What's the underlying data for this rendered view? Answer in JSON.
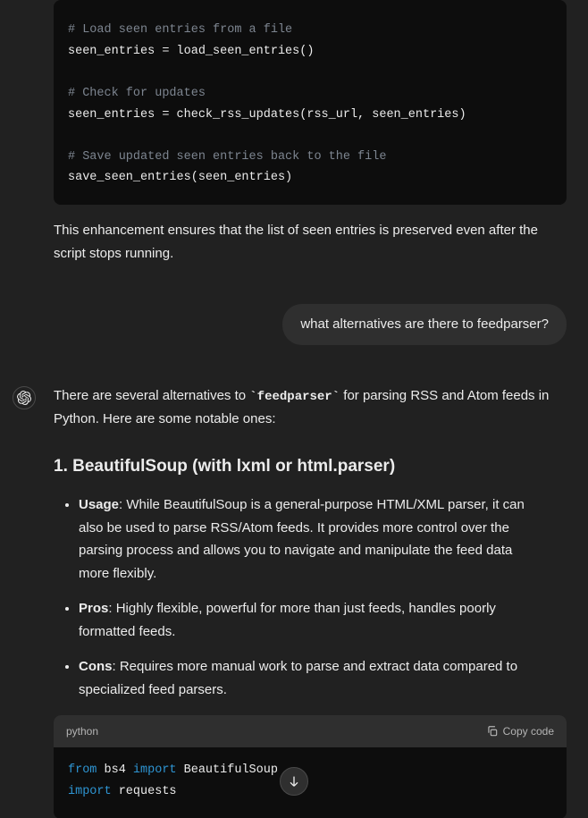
{
  "code1": {
    "c1": "# Load seen entries from a file",
    "l1": "seen_entries = load_seen_entries()",
    "c2": "# Check for updates",
    "l2": "seen_entries = check_rss_updates(rss_url, seen_entries)",
    "c3": "# Save updated seen entries back to the file",
    "l3": "save_seen_entries(seen_entries)"
  },
  "para1": "This enhancement ensures that the list of seen entries is preserved even after the script stops running.",
  "user_q": "what alternatives are there to feedparser?",
  "intro_pre": "There are several alternatives to ",
  "intro_code": "`feedparser`",
  "intro_post": " for parsing RSS and Atom feeds in Python. Here are some notable ones:",
  "heading1": "1. BeautifulSoup (with lxml or html.parser)",
  "bullets": {
    "usage_label": "Usage",
    "usage_text": ": While BeautifulSoup is a general-purpose HTML/XML parser, it can also be used to parse RSS/Atom feeds. It provides more control over the parsing process and allows you to navigate and manipulate the feed data more flexibly.",
    "pros_label": "Pros",
    "pros_text": ": Highly flexible, powerful for more than just feeds, handles poorly formatted feeds.",
    "cons_label": "Cons",
    "cons_text": ": Requires more manual work to parse and extract data compared to specialized feed parsers."
  },
  "code2": {
    "lang": "python",
    "copy": "Copy code",
    "kw_from": "from",
    "mod_bs4": " bs4 ",
    "kw_import1": "import",
    "cls_bs": " BeautifulSoup",
    "kw_import2": "import",
    "mod_requests": " requests"
  }
}
